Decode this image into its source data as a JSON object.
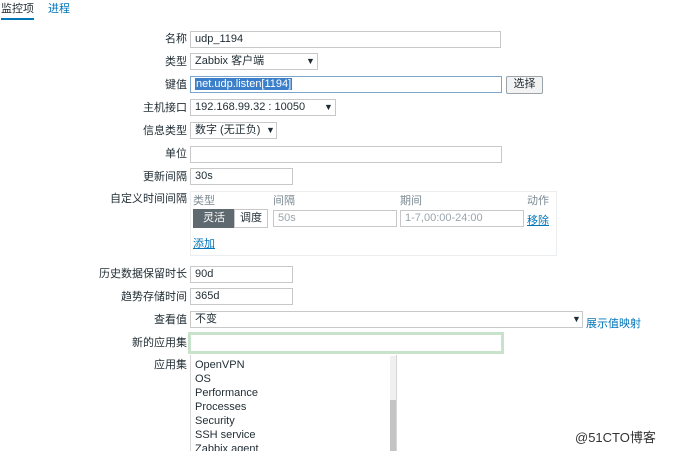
{
  "tabs": {
    "items": [
      "监控项",
      "进程"
    ]
  },
  "form": {
    "name": {
      "label": "名称",
      "value": "udp_1194"
    },
    "type": {
      "label": "类型",
      "value": "Zabbix 客户端"
    },
    "key": {
      "label": "键值",
      "value": "net.udp.listen[1194]",
      "button": "选择"
    },
    "host_interface": {
      "label": "主机接口",
      "value": "192.168.99.32 : 10050"
    },
    "info_type": {
      "label": "信息类型",
      "value": "数字 (无正负)"
    },
    "units": {
      "label": "单位",
      "value": ""
    },
    "update_interval": {
      "label": "更新间隔",
      "value": "30s"
    },
    "custom_intervals": {
      "label": "自定义时间间隔",
      "headers": {
        "type": "类型",
        "interval": "间隔",
        "period": "期间",
        "action": "动作"
      },
      "row": {
        "type_on": "灵活",
        "type_off": "调度",
        "interval_placeholder": "50s",
        "period_placeholder": "1-7,00:00-24:00",
        "remove": "移除"
      },
      "add": "添加"
    },
    "history": {
      "label": "历史数据保留时长",
      "value": "90d"
    },
    "trends": {
      "label": "趋势存储时间",
      "value": "365d"
    },
    "show_value": {
      "label": "查看值",
      "value": "不变",
      "link": "展示值映射"
    },
    "new_application": {
      "label": "新的应用集",
      "value": ""
    },
    "applications": {
      "label": "应用集",
      "items": [
        "OpenVPN",
        "OS",
        "Performance",
        "Processes",
        "Security",
        "SSH service",
        "Zabbix agent"
      ]
    }
  },
  "watermark": "@51CTO博客",
  "colors": {
    "link": "#0275b8",
    "key_highlight": "#3b7ec9",
    "focus_border": "#c9e2cc"
  }
}
